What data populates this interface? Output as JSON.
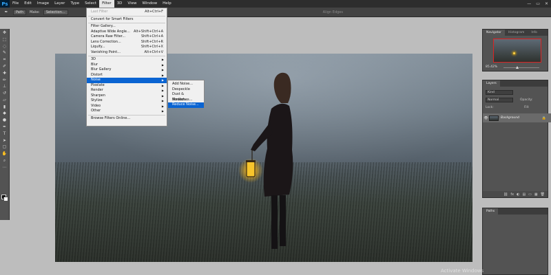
{
  "app": {
    "logo": "Ps"
  },
  "menubar": {
    "items": [
      "File",
      "Edit",
      "Image",
      "Layer",
      "Type",
      "Select",
      "Filter",
      "3D",
      "View",
      "Window",
      "Help"
    ],
    "active": "Filter"
  },
  "window_controls": {
    "minimize": "—",
    "restore": "▭",
    "close": "✕"
  },
  "options_bar": {
    "mode": "Path",
    "make_label": "Make:",
    "make_button": "Selection...",
    "edge_label": "Align Edges"
  },
  "filter_menu": {
    "items": [
      {
        "label": "Last Filter",
        "shortcut": "Alt+Ctrl+F",
        "disabled": true
      },
      {
        "label": "Convert for Smart Filters",
        "shortcut": ""
      },
      {
        "label": "Filter Gallery...",
        "shortcut": ""
      },
      {
        "label": "Adaptive Wide Angle...",
        "shortcut": "Alt+Shift+Ctrl+A"
      },
      {
        "label": "Camera Raw Filter...",
        "shortcut": "Shift+Ctrl+A"
      },
      {
        "label": "Lens Correction...",
        "shortcut": "Shift+Ctrl+R"
      },
      {
        "label": "Liquify...",
        "shortcut": "Shift+Ctrl+X"
      },
      {
        "label": "Vanishing Point...",
        "shortcut": "Alt+Ctrl+V"
      },
      {
        "label": "3D",
        "submenu": true
      },
      {
        "label": "Blur",
        "submenu": true
      },
      {
        "label": "Blur Gallery",
        "submenu": true
      },
      {
        "label": "Distort",
        "submenu": true
      },
      {
        "label": "Noise",
        "submenu": true,
        "highlighted": true
      },
      {
        "label": "Pixelate",
        "submenu": true
      },
      {
        "label": "Render",
        "submenu": true
      },
      {
        "label": "Sharpen",
        "submenu": true
      },
      {
        "label": "Stylize",
        "submenu": true
      },
      {
        "label": "Video",
        "submenu": true
      },
      {
        "label": "Other",
        "submenu": true
      },
      {
        "label": "Browse Filters Online...",
        "shortcut": ""
      }
    ],
    "submenu_arrow": "▶"
  },
  "noise_submenu": {
    "items": [
      "Add Noise...",
      "Despeckle",
      "Dust & Scratches...",
      "Median...",
      "Reduce Noise..."
    ],
    "highlighted": "Reduce Noise..."
  },
  "navigator": {
    "tabs": [
      "Navigator",
      "Histogram",
      "Info"
    ],
    "zoom": "85.42%"
  },
  "layers": {
    "tabs": [
      "Layers"
    ],
    "kind_label": "Kind",
    "blend_mode": "Normal",
    "opacity_label": "Opacity:",
    "lock_label": "Lock:",
    "fill_label": "Fill:",
    "layer_name": "Background",
    "eye_glyph": "👁",
    "lock_glyph": "🔒",
    "footer_glyphs": [
      "⛓",
      "fx",
      "◐",
      "▤",
      "▭",
      "▦",
      "🗑"
    ]
  },
  "paths": {
    "tabs": [
      "Paths"
    ]
  },
  "watermark": {
    "text": "Activate Windows"
  },
  "colors": {
    "accent": "#0a64d2",
    "lantern": "#ffd24a"
  }
}
